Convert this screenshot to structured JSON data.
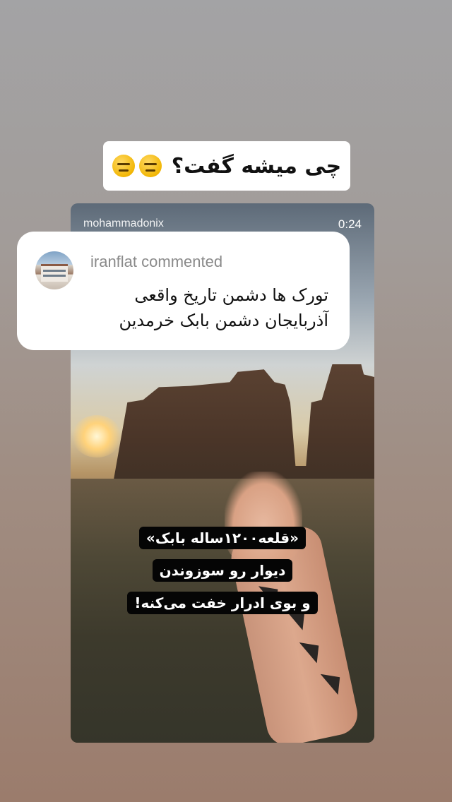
{
  "story_title": {
    "text": "چی میشه گفت؟",
    "emojis": [
      "expressionless-face-icon",
      "expressionless-face-icon"
    ]
  },
  "video": {
    "author": "mohammadonix",
    "duration": "0:24",
    "captions": [
      "«قلعه۱۲۰۰ساله بابک»",
      "دیوار رو سوزوندن",
      "و بوی ادرار خفت می‌کنه!"
    ]
  },
  "comment": {
    "header": "iranflat commented",
    "lines": [
      "تورک ها دشمن تاریخ واقعی",
      "آذربایجان دشمن بابک خرمدین"
    ]
  }
}
